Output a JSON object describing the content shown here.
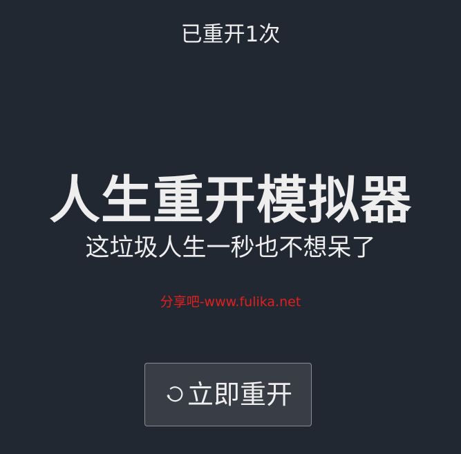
{
  "header": {
    "restart_count_text": "已重开1次"
  },
  "main": {
    "title": "人生重开模拟器",
    "subtitle": "这垃圾人生一秒也不想呆了",
    "watermark": "分享吧-www.fulika.net"
  },
  "actions": {
    "restart_label": "立即重开",
    "restart_icon": "rotate-ccw-icon"
  },
  "colors": {
    "background": "#222831",
    "text": "#eeeeee",
    "button_bg": "#393e46",
    "watermark": "#e02020"
  }
}
